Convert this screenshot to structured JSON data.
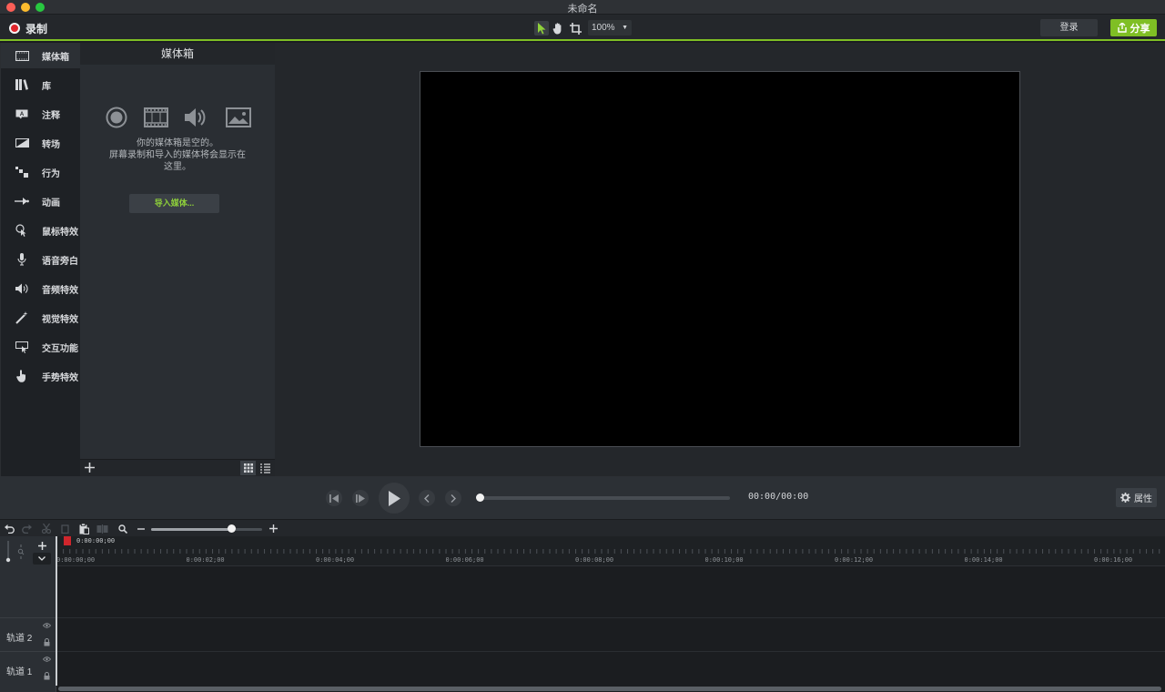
{
  "window": {
    "title": "未命名"
  },
  "toolbar": {
    "record_label": "录制",
    "zoom_value": "100%",
    "login_label": "登录",
    "share_label": "分享",
    "accent_color": "#7fbf24"
  },
  "sidebar": {
    "items": [
      {
        "label": "媒体箱",
        "icon": "film-strip-icon",
        "active": true
      },
      {
        "label": "库",
        "icon": "library-icon"
      },
      {
        "label": "注释",
        "icon": "annotation-icon"
      },
      {
        "label": "转场",
        "icon": "transition-icon"
      },
      {
        "label": "行为",
        "icon": "behavior-icon"
      },
      {
        "label": "动画",
        "icon": "animation-arrow-icon"
      },
      {
        "label": "鼠标特效",
        "icon": "cursor-effect-icon"
      },
      {
        "label": "语音旁白",
        "icon": "microphone-icon"
      },
      {
        "label": "音频特效",
        "icon": "speaker-icon"
      },
      {
        "label": "视觉特效",
        "icon": "magic-wand-icon"
      },
      {
        "label": "交互功能",
        "icon": "interactive-icon"
      },
      {
        "label": "手势特效",
        "icon": "hand-gesture-icon"
      }
    ]
  },
  "media_bin": {
    "title": "媒体箱",
    "empty_line1": "你的媒体箱是空的。",
    "empty_line2": "屏幕录制和导入的媒体将会显示在",
    "empty_line3": "这里。",
    "import_label": "导入媒体..."
  },
  "playback": {
    "timecode": "00:00/00:00",
    "properties_label": "属性"
  },
  "timeline": {
    "playhead_time": "0:00:00;00",
    "ticks": [
      "0:00:00;00",
      "0:00:02;00",
      "0:00:04;00",
      "0:00:06;00",
      "0:00:08;00",
      "0:00:10;00",
      "0:00:12;00",
      "0:00:14;00",
      "0:00:16;00"
    ],
    "tracks": [
      {
        "label": "轨道 2"
      },
      {
        "label": "轨道 1"
      }
    ]
  }
}
